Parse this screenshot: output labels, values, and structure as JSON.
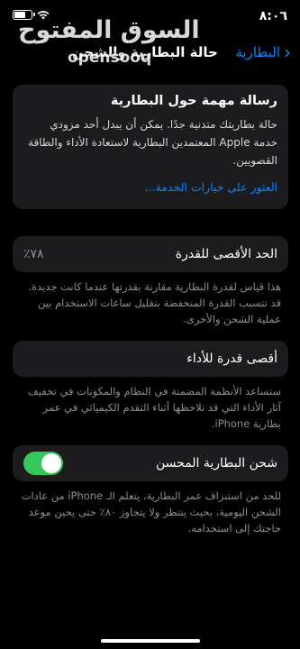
{
  "status_bar": {
    "time": "٨:٠٦",
    "battery_level": 0.78
  },
  "watermark": {
    "arabic": "السوق المفتوح",
    "english": "opensooq"
  },
  "nav": {
    "back_label": "البطارية",
    "title": "حالة البطارية والشحن"
  },
  "important_message": {
    "title": "رسالة مهمة حول البطارية",
    "body": "حالة بطاريتك متدنية جدًا. يمكن أن يبدل أحد مزودي خدمة Apple المعتمدين البطارية لاستعادة الأداء والطاقة القصويين.",
    "link": "العثور على خيارات الخدمة..."
  },
  "maximum_capacity": {
    "label": "الحد الأقصى للقدرة",
    "value": "٪٧٨",
    "footnote": "هذا قياس لقدرة البطارية مقارنة بقدرتها عندما كانت جديدة. قد تتسبب القدرة المنخفضة بتقليل ساعات الاستخدام بين عملية الشحن والأخرى."
  },
  "peak_performance": {
    "label": "أقصى قدرة للأداء",
    "footnote": "ستساعد الأنظمة المضمنة في النظام والمكونات في تخفيف آثار الأداء التي قد تلاحظها أثناء التقدم الكيميائي في عمر بطارية iPhone."
  },
  "optimized_charging": {
    "label": "شحن البطارية المحسن",
    "enabled": true,
    "footnote": "للحد من استنزاف عمر البطارية، يتعلم الـ iPhone من عادات الشحن اليومية، بحيث ينتظر ولا يتجاوز ٨٠٪ حتى يحين موعد حاجتك إلى استخدامه."
  },
  "colors": {
    "background": "#000000",
    "card": "#1c1c1e",
    "accent_blue": "#0a84ff",
    "toggle_on": "#34c759",
    "secondary_text": "#8e8e93"
  }
}
